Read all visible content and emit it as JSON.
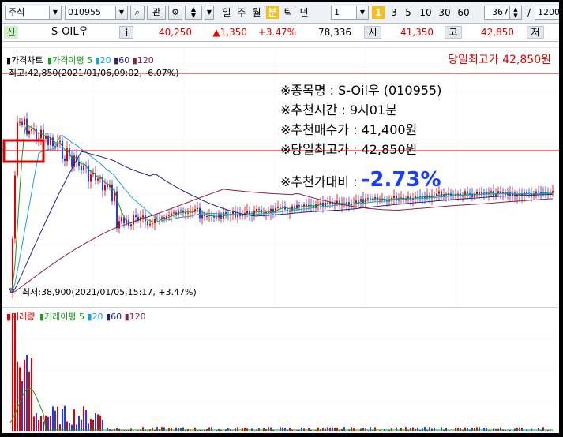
{
  "toolbar": {
    "market_label": "주식",
    "code_value": "010955",
    "btn_gwan": "관",
    "periods": [
      "일",
      "주",
      "월",
      "분",
      "틱",
      "년"
    ],
    "active_period": "분",
    "interval_value": "1",
    "minute_active": "1",
    "minutes": [
      "3",
      "5",
      "10",
      "30",
      "60"
    ],
    "count_value": "367",
    "slash": "/",
    "total_value": "1200"
  },
  "quote": {
    "tag": "신",
    "name": "S-OIL우",
    "info_btn": "i",
    "price": "40,250",
    "change": "▲1,350",
    "change_pct": "+3.47%",
    "volume": "78,336",
    "open_label": "시",
    "open_value": "41,350",
    "high_label": "고",
    "high_value": "42,850",
    "low_label": "저"
  },
  "chart": {
    "legend_price": [
      "가격차트",
      "가격이평",
      "5",
      "20",
      "60",
      "120"
    ],
    "legend_volume": [
      "거래량",
      "거래이평",
      "5",
      "20",
      "60",
      "120"
    ],
    "top_note": "당일최고가 42,850원",
    "high_marker": "최고:42,850(2021/01/06,09:02, -6.07%)",
    "low_marker": "최저:38,900(2021/01/05,15:17, +3.47%)",
    "info": {
      "line1": "※종목명 : S-Oil우 (010955)",
      "line2": "※추천시간 : 9시01분",
      "line3": "※추천매수가 : 41,400원",
      "line4": "※당일최고가 : 42,850원",
      "line5_label": "※추천가대비 :",
      "line5_value": "-2.73%"
    },
    "colors": {
      "up": "#e00000",
      "down": "#1a3cff",
      "ma5": "#f08020",
      "ma20": "#1aa0e0",
      "ma60": "#20208a",
      "ma120": "#8a2040",
      "ref_line": "#d00000",
      "highlight_box": "#e00000",
      "info_accent": "#1a3cff"
    }
  }
}
